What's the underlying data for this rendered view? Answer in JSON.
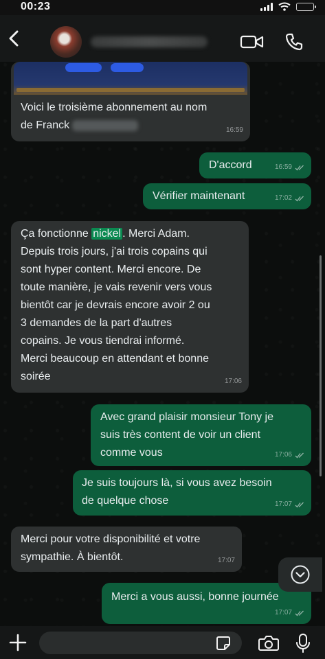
{
  "status_bar": {
    "time": "00:23"
  },
  "header": {
    "contact_name": ""
  },
  "messages": [
    {
      "id": "m1",
      "dir": "in",
      "text": "Voici le troisième abonnement au nom\nde Franck",
      "time": "16:59"
    },
    {
      "id": "m2",
      "dir": "out",
      "text": "D'accord",
      "time": "16:59"
    },
    {
      "id": "m3",
      "dir": "out",
      "text": "Vérifier maintenant",
      "time": "17:02"
    },
    {
      "id": "m4",
      "dir": "in",
      "highlight": "nickel",
      "text_pre": "Ça fonctionne ",
      "text_post": ". Merci Adam.\nDepuis trois jours, j'ai trois copains qui\nsont hyper content. Merci encore. De\ntoute manière, je vais revenir vers vous\nbientôt car je devrais encore avoir 2 ou\n3 demandes de la part d'autres\ncopains. Je vous tiendrai informé.\nMerci beaucoup en attendant et bonne\nsoirée",
      "time": "17:06"
    },
    {
      "id": "m5",
      "dir": "out",
      "text": "Avec grand plaisir monsieur Tony je\nsuis très content de voir un client\ncomme vous",
      "time": "17:06"
    },
    {
      "id": "m6",
      "dir": "out",
      "text": "Je suis toujours là, si vous avez besoin\nde quelque chose",
      "time": "17:07"
    },
    {
      "id": "m7",
      "dir": "in",
      "text": "Merci pour votre disponibilité et votre\nsympathie. À bientôt.",
      "time": "17:07"
    },
    {
      "id": "m8",
      "dir": "out",
      "text": "Merci a vous aussi, bonne journée",
      "time": "17:07"
    }
  ],
  "input": {
    "placeholder": ""
  },
  "icons": [
    "back-icon",
    "video-icon",
    "phone-icon",
    "chevron-down-icon",
    "plus-icon",
    "sticker-icon",
    "camera-icon",
    "mic-icon"
  ],
  "colors": {
    "incoming": "#2e3131",
    "outgoing": "#0d5e3c",
    "highlight": "#0b8a51",
    "background": "#0c0e0d"
  }
}
